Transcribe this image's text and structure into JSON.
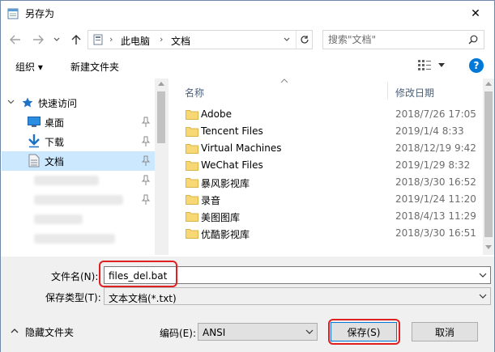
{
  "window": {
    "title": "另存为",
    "close_glyph": "✕"
  },
  "nav": {
    "back_icon": "arrow-left-icon",
    "forward_icon": "arrow-right-icon",
    "history_icon": "chevron-down-icon",
    "up_icon": "arrow-up-icon",
    "breadcrumb": [
      "此电脑",
      "文档"
    ],
    "refresh_icon": "refresh-icon",
    "search_placeholder": "搜索\"文档\""
  },
  "toolbar": {
    "organize_label": "组织 ▾",
    "new_folder_label": "新建文件夹",
    "view_icon": "view-list-icon",
    "help_label": "?"
  },
  "sidebar": {
    "quick_access": "快速访问",
    "items": [
      {
        "label": "桌面",
        "icon": "desktop-icon",
        "pinned": true
      },
      {
        "label": "下载",
        "icon": "download-icon",
        "pinned": true
      },
      {
        "label": "文档",
        "icon": "documents-icon",
        "pinned": true,
        "selected": true
      }
    ]
  },
  "file_list": {
    "col_name": "名称",
    "col_date": "修改日期",
    "rows": [
      {
        "name": "Adobe",
        "date": "2018/7/26 17:05"
      },
      {
        "name": "Tencent Files",
        "date": "2019/1/4 8:33"
      },
      {
        "name": "Virtual Machines",
        "date": "2018/12/19 9:42"
      },
      {
        "name": "WeChat Files",
        "date": "2019/1/29 8:32"
      },
      {
        "name": "暴风影视库",
        "date": "2018/3/30 16:52"
      },
      {
        "name": "录音",
        "date": "2019/1/24 11:20"
      },
      {
        "name": "美图图库",
        "date": "2018/4/13 11:29"
      },
      {
        "name": "优酷影视库",
        "date": "2018/3/30 16:51"
      }
    ]
  },
  "form": {
    "filename_label": "文件名(N):",
    "filename_value": "files_del.bat",
    "filetype_label": "保存类型(T):",
    "filetype_value": "文本文档(*.txt)",
    "encoding_label": "编码(E):",
    "encoding_value": "ANSI",
    "hide_folders_label": "隐藏文件夹",
    "save_label": "保存(S)",
    "cancel_label": "取消"
  },
  "colors": {
    "accent": "#0078d7",
    "selection": "#cce8ff",
    "folder": "#f8d775",
    "highlight": "#e02020"
  }
}
